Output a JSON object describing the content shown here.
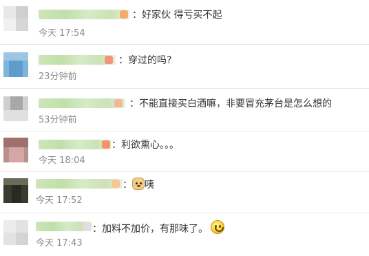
{
  "comments": [
    {
      "content": "：好家伙 得亏买不起",
      "time": "今天 17:54"
    },
    {
      "content": "：穿过的吗?",
      "time": "23分钟前"
    },
    {
      "content": "：不能直接买白酒嘛，非要冒充茅台是怎么想的",
      "time": "53分钟前"
    },
    {
      "content": "：利欲熏心。。。",
      "time": "今天 18:04"
    },
    {
      "content_prefix": "：",
      "content_suffix": "咦",
      "emoji": "doge-emoji",
      "time": "今天 17:52"
    },
    {
      "content": "：加料不加价，有那味了。",
      "emoji": "smile-emoji",
      "time": "今天 17:43"
    }
  ],
  "colors": {
    "divider": "#e6e6e6",
    "time_text": "#8a8a8a",
    "body_text": "#333333",
    "username_blur": "#b9dca0"
  }
}
